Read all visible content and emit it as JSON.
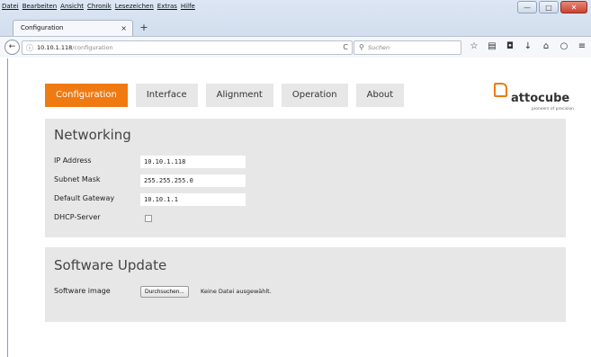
{
  "browser": {
    "menu": [
      "Datei",
      "Bearbeiten",
      "Ansicht",
      "Chronik",
      "Lesezeichen",
      "Extras",
      "Hilfe"
    ],
    "window_buttons": {
      "minimize": "—",
      "maximize": "□",
      "close": "✕"
    },
    "tab": {
      "title": "Configuration",
      "close": "×"
    },
    "newtab": "+",
    "back": "←",
    "url": {
      "host": "10.10.1.118",
      "path": "/configuration"
    },
    "reload": "C",
    "search_placeholder": "Suchen"
  },
  "nav": {
    "tabs": [
      {
        "label": "Configuration",
        "active": true
      },
      {
        "label": "Interface",
        "active": false
      },
      {
        "label": "Alignment",
        "active": false
      },
      {
        "label": "Operation",
        "active": false
      },
      {
        "label": "About",
        "active": false
      }
    ]
  },
  "brand": {
    "name": "attocube",
    "tagline": "pioneers of precision",
    "accent": "#f07a12"
  },
  "networking": {
    "title": "Networking",
    "fields": [
      {
        "label": "IP Address",
        "value": "10.10.1.118"
      },
      {
        "label": "Subnet Mask",
        "value": "255.255.255.0"
      },
      {
        "label": "Default Gateway",
        "value": "10.10.1.1"
      }
    ],
    "dhcp": {
      "label": "DHCP-Server",
      "checked": false
    }
  },
  "software_update": {
    "title": "Software Update",
    "image_label": "Software image",
    "browse_button": "Durchsuchen...",
    "file_status": "Keine Datei ausgewählt."
  }
}
